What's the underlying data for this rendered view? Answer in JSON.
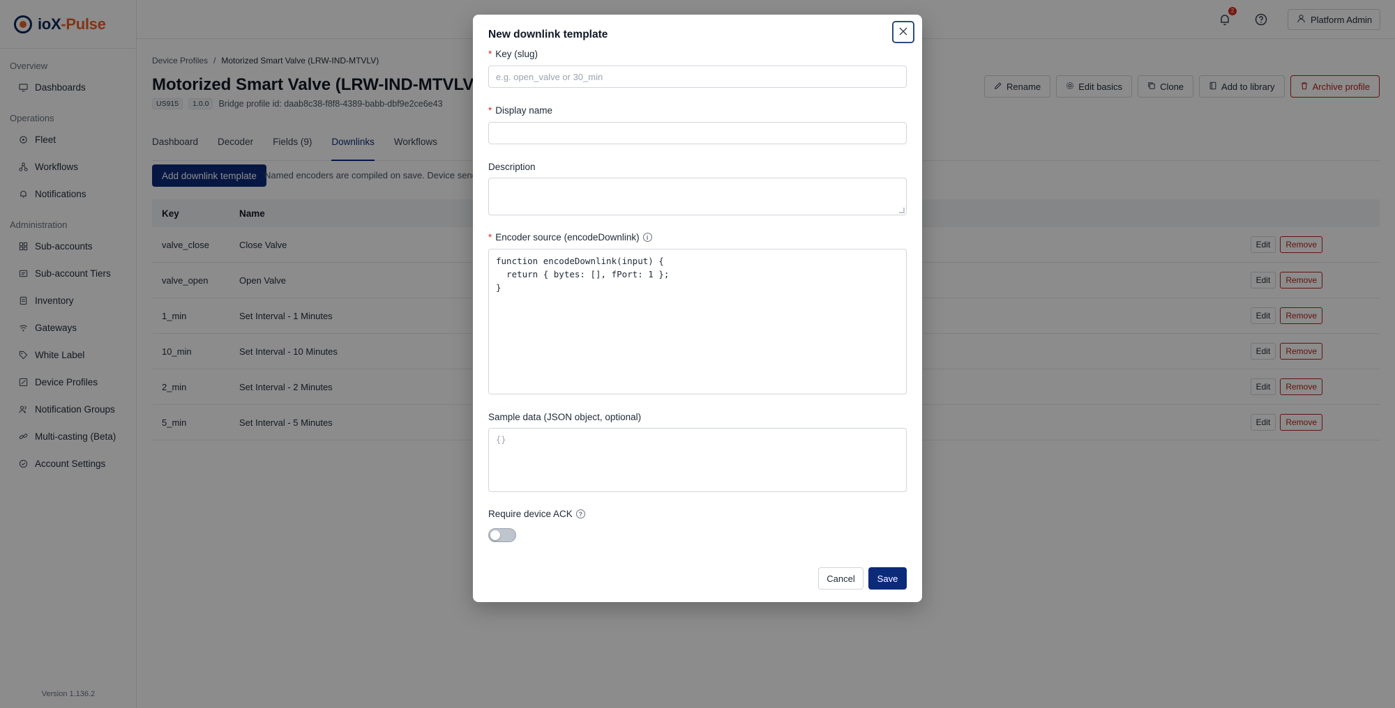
{
  "brand": {
    "name_main": "ioX",
    "name_dash": "-",
    "name_accent": "Pulse"
  },
  "sidebar": {
    "sections": [
      {
        "label": "Overview",
        "items": [
          {
            "label": "Dashboards",
            "icon": "monitor-icon"
          }
        ]
      },
      {
        "label": "Operations",
        "items": [
          {
            "label": "Fleet",
            "icon": "fleet-icon"
          },
          {
            "label": "Workflows",
            "icon": "workflow-icon"
          },
          {
            "label": "Notifications",
            "icon": "bell-icon"
          }
        ]
      },
      {
        "label": "Administration",
        "items": [
          {
            "label": "Sub-accounts",
            "icon": "grid-icon"
          },
          {
            "label": "Sub-account Tiers",
            "icon": "tiers-icon"
          },
          {
            "label": "Inventory",
            "icon": "inventory-icon"
          },
          {
            "label": "Gateways",
            "icon": "wifi-icon"
          },
          {
            "label": "White Label",
            "icon": "tag-icon"
          },
          {
            "label": "Device Profiles",
            "icon": "profile-icon"
          },
          {
            "label": "Notification Groups",
            "icon": "group-icon"
          },
          {
            "label": "Multi-casting (Beta)",
            "icon": "link-icon"
          },
          {
            "label": "Account Settings",
            "icon": "shield-check-icon"
          }
        ]
      }
    ],
    "version": "Version 1.136.2"
  },
  "topbar": {
    "notification_count": "2",
    "user_label": "Platform Admin"
  },
  "page": {
    "breadcrumb_root": "Device Profiles",
    "breadcrumb_sep": "/",
    "breadcrumb_current": "Motorized Smart Valve (LRW-IND-MTVLV)",
    "title": "Motorized Smart Valve (LRW-IND-MTVLV)",
    "region_tag": "US915",
    "version_tag": "1.0.0",
    "bridge_id": "Bridge profile id: daab8c38-f8f8-4389-babb-dbf9e2ce6e43",
    "actions": {
      "rename": "Rename",
      "edit_basics": "Edit basics",
      "clone": "Clone",
      "add_library": "Add to library",
      "archive": "Archive profile"
    },
    "tabs": [
      "Dashboard",
      "Decoder",
      "Fields (9)",
      "Downlinks",
      "Workflows"
    ],
    "active_tab": "Downlinks",
    "add_button": "Add downlink template",
    "hint": "Named encoders are compiled on save. Device send m",
    "table": {
      "col_key": "Key",
      "col_name": "Name",
      "edit_label": "Edit",
      "remove_label": "Remove",
      "rows": [
        {
          "key": "valve_close",
          "name": "Close Valve"
        },
        {
          "key": "valve_open",
          "name": "Open Valve"
        },
        {
          "key": "1_min",
          "name": "Set Interval - 1 Minutes"
        },
        {
          "key": "10_min",
          "name": "Set Interval - 10 Minutes"
        },
        {
          "key": "2_min",
          "name": "Set Interval - 2 Minutes"
        },
        {
          "key": "5_min",
          "name": "Set Interval - 5 Minutes"
        }
      ]
    }
  },
  "modal": {
    "title": "New downlink template",
    "required_mark": "*",
    "key_label": "Key (slug)",
    "key_placeholder": "e.g. open_valve or 30_min",
    "key_value": "",
    "display_name_label": "Display name",
    "display_name_value": "",
    "description_label": "Description",
    "description_value": "",
    "encoder_label": "Encoder source (encodeDownlink)",
    "encoder_value": "function encodeDownlink(input) {\n  return { bytes: [], fPort: 1 };\n}",
    "sample_label": "Sample data (JSON object, optional)",
    "sample_placeholder": "{}",
    "ack_label": "Require device ACK",
    "ack_enabled": false,
    "cancel_label": "Cancel",
    "save_label": "Save"
  }
}
